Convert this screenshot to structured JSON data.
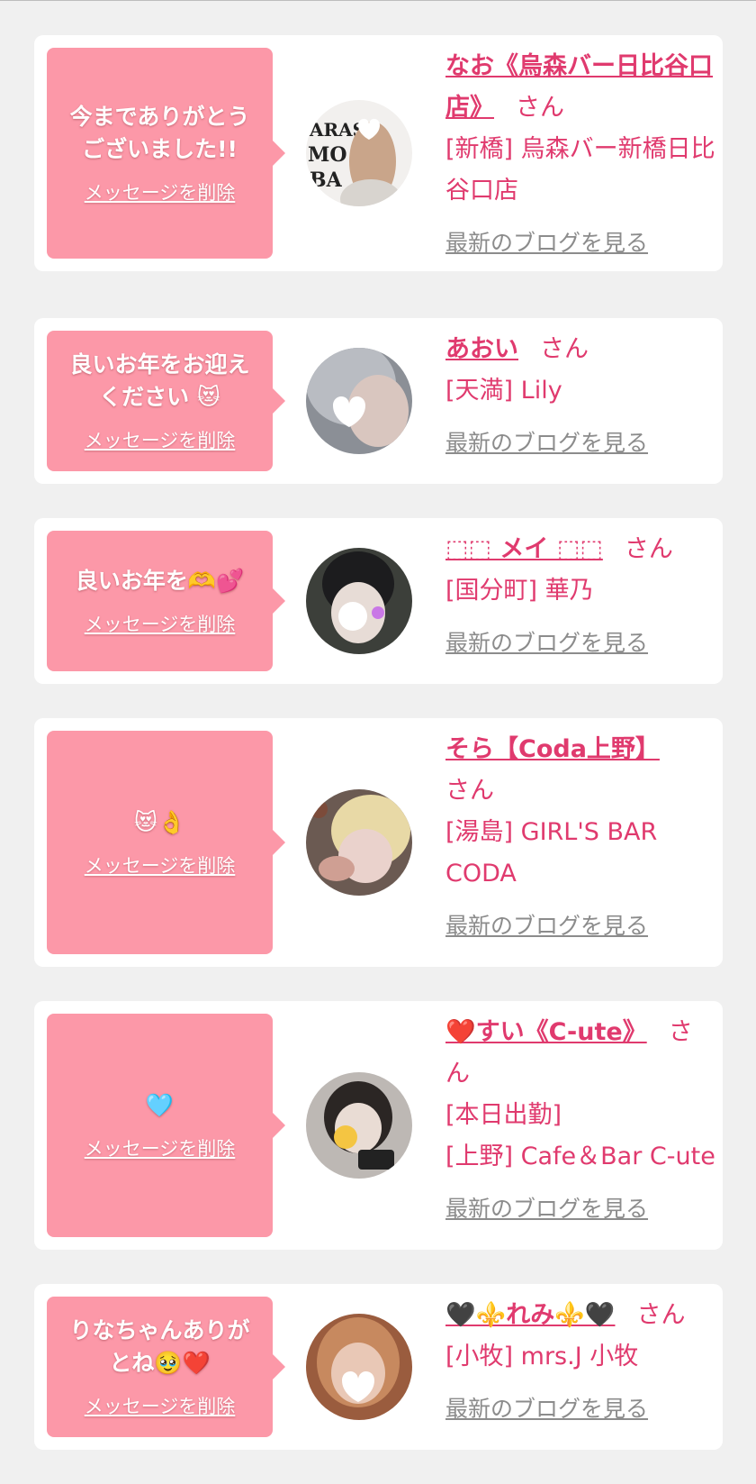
{
  "page": {
    "accent": "#e03a6e",
    "bubble_color": "#fc98a8",
    "background": "#f0f0f0"
  },
  "delete_label": "メッセージを削除",
  "blog_label": "最新のブログを見る",
  "honorific": "さん",
  "items": [
    {
      "message": "今までありがとう\nございました!!",
      "name": "なお《烏森バー日比谷口店》",
      "shop": "[新橋] 烏森バー新橋日比谷口店",
      "avatar_icon": "photo-avatar"
    },
    {
      "message": "良いお年をお迎え\nください 😻",
      "name": "あおい",
      "shop": "[天満] Lily",
      "avatar_icon": "photo-avatar"
    },
    {
      "message": "良いお年を🫶💕",
      "name": "⬚⬚ メイ ⬚⬚",
      "shop": "[国分町] 華乃",
      "avatar_icon": "photo-avatar"
    },
    {
      "message": "😻👌",
      "name": "そら【Coda上野】",
      "shop": "[湯島] GIRL'S BAR CODA",
      "avatar_icon": "photo-avatar"
    },
    {
      "message": "🩵",
      "name": "❤️すい《C-ute》",
      "shop_status": "[本日出勤]",
      "shop": "[上野] Cafe＆Bar C-ute",
      "avatar_icon": "photo-avatar"
    },
    {
      "message": "りなちゃんありが\nとね🥹❤️",
      "name": "🖤⚜️れみ⚜️🖤",
      "shop": "[小牧] mrs.J 小牧",
      "avatar_icon": "photo-avatar"
    }
  ]
}
